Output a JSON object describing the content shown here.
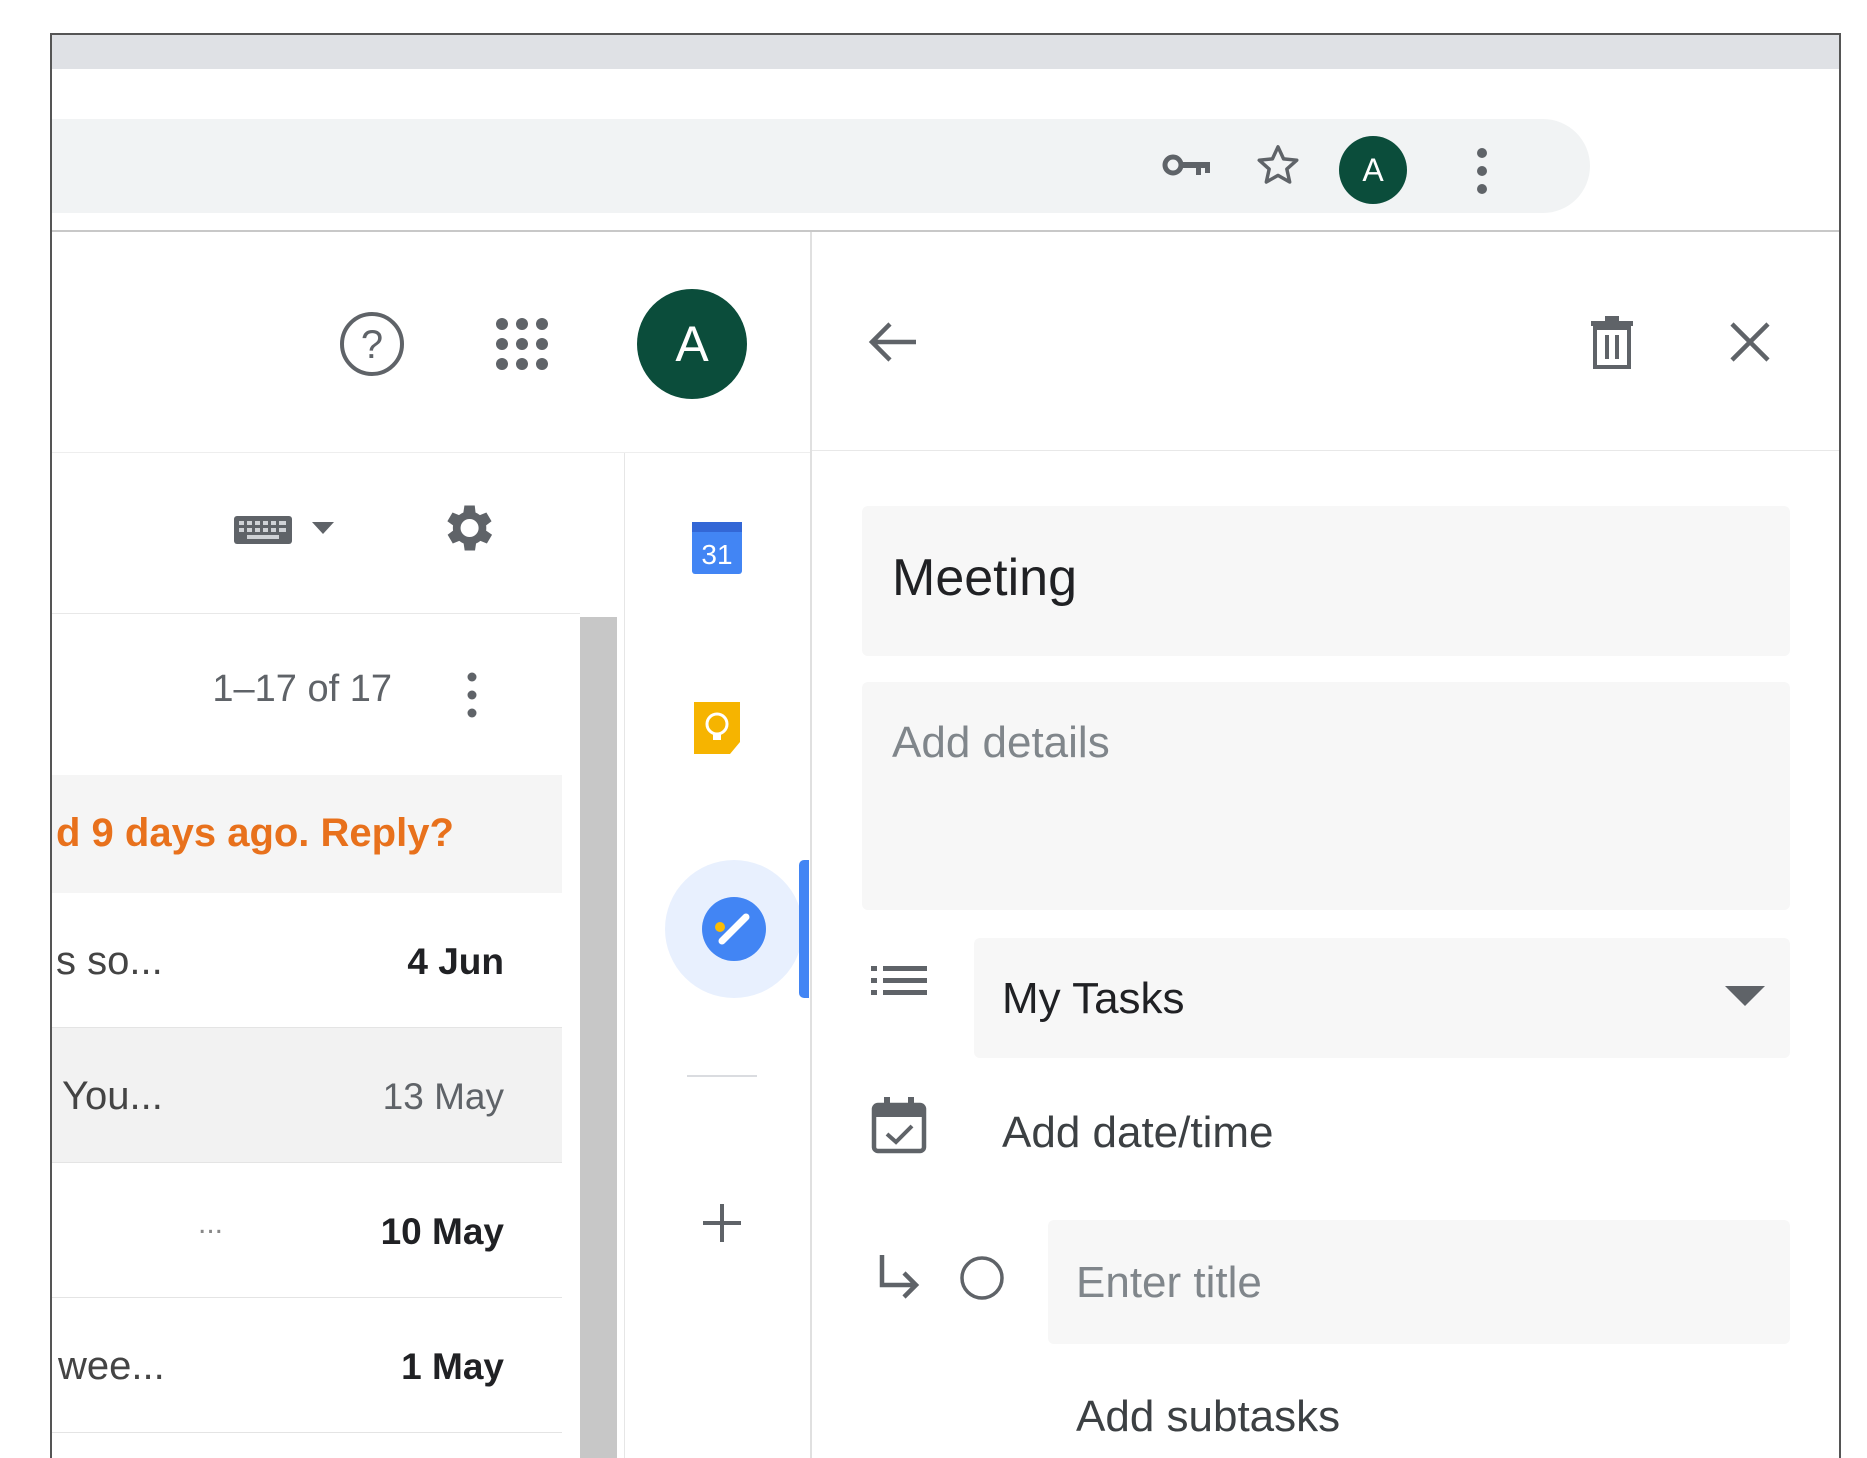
{
  "browser": {
    "profile_initial": "A",
    "icons": [
      "key-icon",
      "star-icon",
      "more-vert-icon"
    ]
  },
  "gmail": {
    "profile_initial": "A",
    "icons": [
      "help-icon",
      "apps-grid-icon",
      "keyboard-icon",
      "dropdown-arrow-icon",
      "settings-gear-icon",
      "more-vert-icon"
    ],
    "pagination": "1–17 of 17",
    "nudge_text": "d 9 days ago. Reply?",
    "nudge_color": "#e8711c",
    "rows": [
      {
        "snippet": "s so...",
        "date": "4 Jun",
        "unread": true
      },
      {
        "snippet": "You...",
        "date": "13 May",
        "unread": false
      },
      {
        "snippet": "...",
        "date": "10 May",
        "unread": true
      },
      {
        "snippet": "wee...",
        "date": "1 May",
        "unread": true
      }
    ]
  },
  "side_rail": {
    "items": [
      {
        "name": "calendar-app-icon",
        "label": "31"
      },
      {
        "name": "keep-app-icon"
      },
      {
        "name": "tasks-app-icon",
        "active": true
      }
    ],
    "add_icon": "plus-icon",
    "accent": "#4285f4"
  },
  "task_panel": {
    "icons": [
      "back-arrow-icon",
      "delete-icon",
      "close-icon"
    ],
    "title": "Meeting",
    "details_placeholder": "Add details",
    "list_selected": "My Tasks",
    "add_date_label": "Add date/time",
    "subtask_placeholder": "Enter title",
    "add_subtasks_label": "Add subtasks"
  }
}
